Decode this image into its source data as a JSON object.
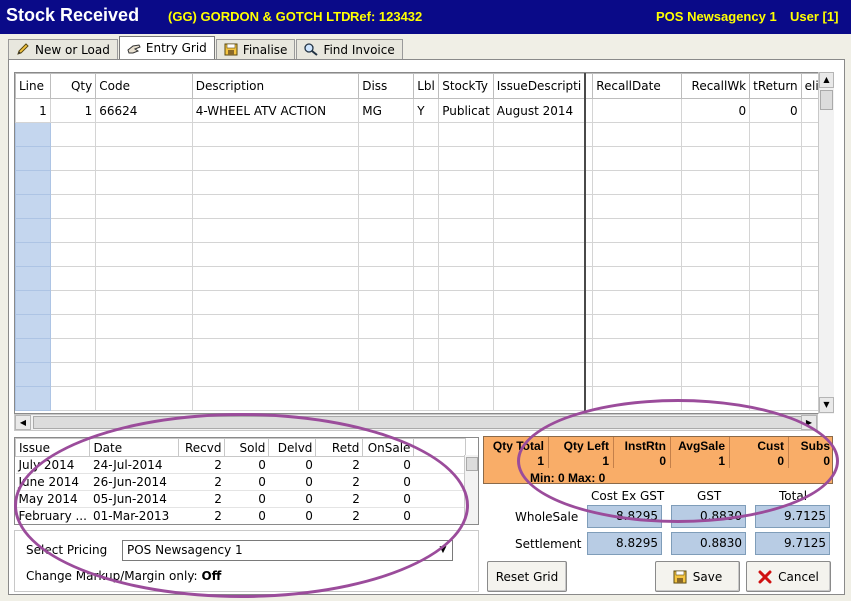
{
  "header": {
    "title": "Stock Received",
    "supplier": "(GG) GORDON & GOTCH LTD",
    "ref": "Ref: 123432",
    "location": "POS Newsagency 1",
    "user": "User [1]"
  },
  "tabs": [
    {
      "label": "New or Load",
      "icon": "pencil-icon"
    },
    {
      "label": "Entry Grid",
      "icon": "hand-icon"
    },
    {
      "label": "Finalise",
      "icon": "floppy-icon"
    },
    {
      "label": "Find Invoice",
      "icon": "magnifier-icon"
    }
  ],
  "grid": {
    "columns": [
      "Line",
      "Qty",
      "Code",
      "Description",
      "Diss",
      "Lbl",
      "StockTy",
      "IssueDescripti",
      "",
      "RecallDate",
      "RecallWk",
      "tReturn",
      "eli"
    ],
    "rows": [
      [
        "1",
        "1",
        "66624",
        "4-WHEEL ATV ACTION",
        "MG",
        "Y",
        "Publicat",
        "August 2014",
        "",
        "",
        "0",
        "0",
        ""
      ]
    ],
    "empty_rows": 12
  },
  "history": {
    "columns": [
      "Issue",
      "Date",
      "Recvd",
      "Sold",
      "Delvd",
      "Retd",
      "OnSale"
    ],
    "rows": [
      [
        "July 2014",
        "24-Jul-2014",
        "2",
        "0",
        "0",
        "2",
        "0"
      ],
      [
        "June 2014",
        "26-Jun-2014",
        "2",
        "0",
        "0",
        "2",
        "0"
      ],
      [
        "May 2014",
        "05-Jun-2014",
        "2",
        "0",
        "0",
        "2",
        "0"
      ],
      [
        "February ...",
        "01-Mar-2013",
        "2",
        "0",
        "0",
        "2",
        "0"
      ]
    ]
  },
  "pricing": {
    "select_label": "Select Pricing",
    "selected": "POS Newsagency 1",
    "markup_label": "Change Markup/Margin only:",
    "markup_value": "Off"
  },
  "stats": {
    "cells": [
      {
        "label": "Qty Total",
        "value": "1"
      },
      {
        "label": "Qty Left",
        "value": "1"
      },
      {
        "label": "InstRtn",
        "value": "0"
      },
      {
        "label": "AvgSale",
        "value": "1"
      },
      {
        "label": "Cust",
        "value": "0"
      },
      {
        "label": "Subs",
        "value": "0"
      }
    ],
    "minmax": "Min: 0  Max: 0"
  },
  "costs": {
    "headers": [
      "Cost Ex GST",
      "GST",
      "Total"
    ],
    "rows": [
      {
        "label": "WholeSale",
        "values": [
          "8.8295",
          "0.8830",
          "9.7125"
        ]
      },
      {
        "label": "Settlement",
        "values": [
          "8.8295",
          "0.8830",
          "9.7125"
        ]
      }
    ]
  },
  "buttons": {
    "reset": "Reset Grid",
    "save": "Save",
    "cancel": "Cancel"
  },
  "colors": {
    "titlebar": "#0a0a88",
    "title_accent": "#ffff00",
    "stats_bg": "#f9ad68",
    "value_box": "#b8cce4",
    "annotation": "#9b4c9b"
  }
}
